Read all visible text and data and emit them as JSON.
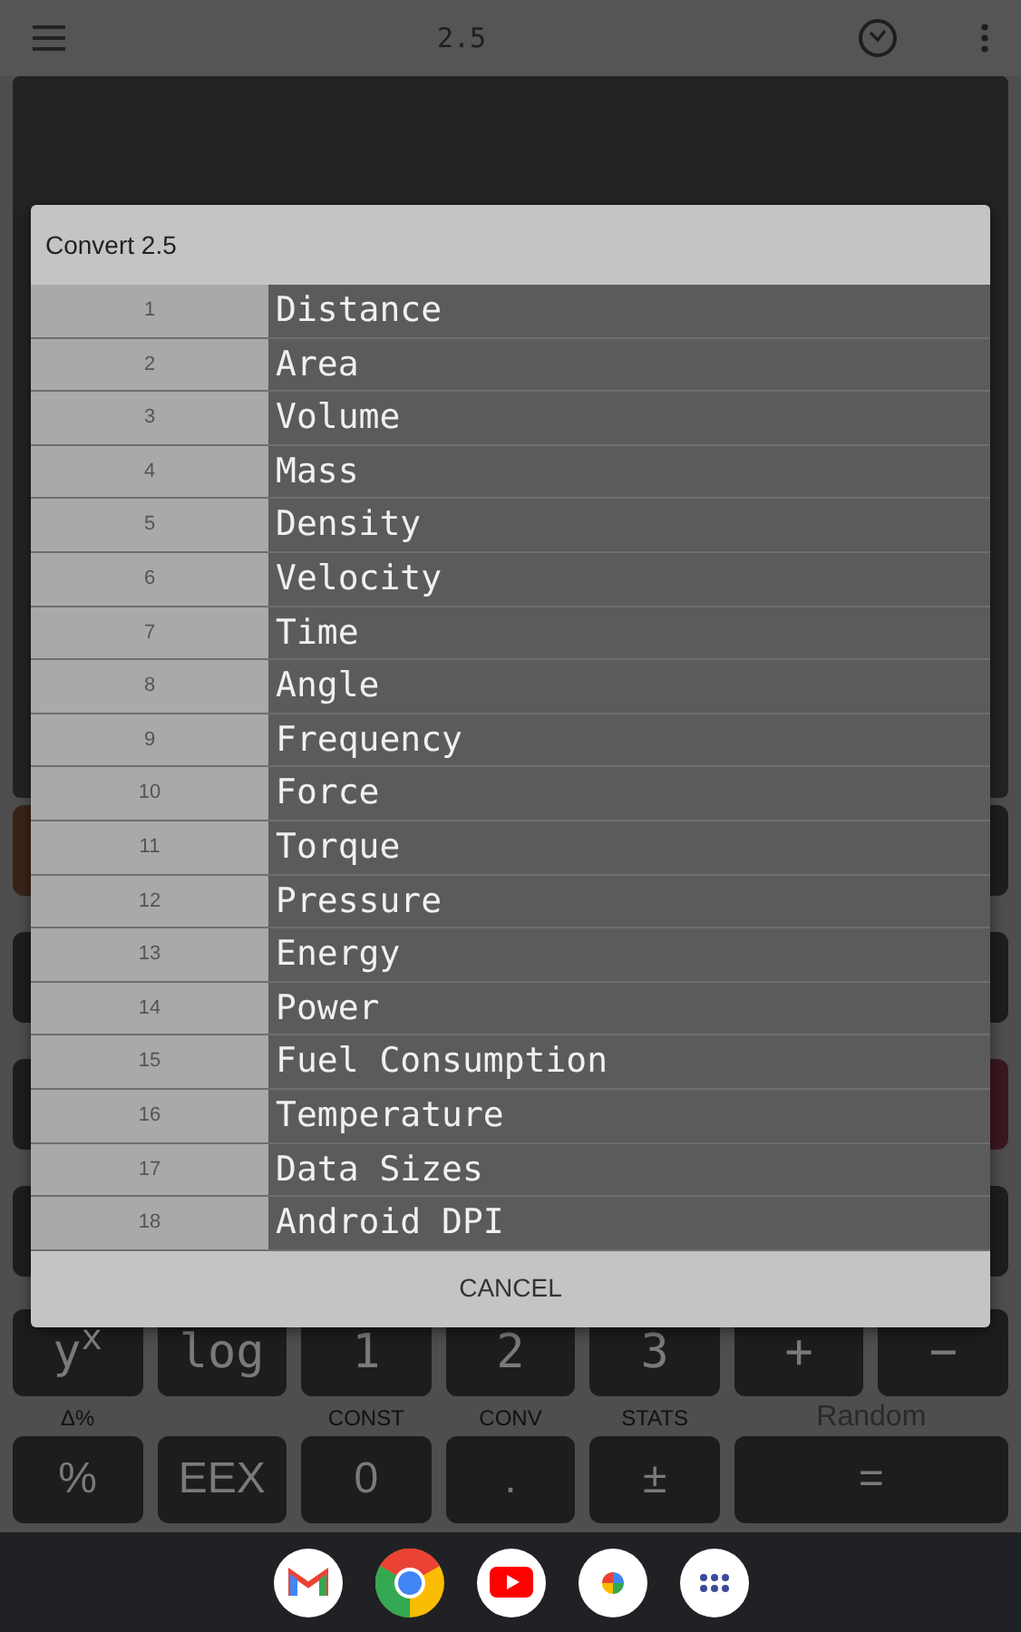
{
  "top_bar": {
    "title": "2.5"
  },
  "dialog": {
    "title": "Convert 2.5",
    "items": [
      {
        "number": "1",
        "label": "Distance"
      },
      {
        "number": "2",
        "label": "Area"
      },
      {
        "number": "3",
        "label": "Volume"
      },
      {
        "number": "4",
        "label": "Mass"
      },
      {
        "number": "5",
        "label": "Density"
      },
      {
        "number": "6",
        "label": "Velocity"
      },
      {
        "number": "7",
        "label": "Time"
      },
      {
        "number": "8",
        "label": "Angle"
      },
      {
        "number": "9",
        "label": "Frequency"
      },
      {
        "number": "10",
        "label": "Force"
      },
      {
        "number": "11",
        "label": "Torque"
      },
      {
        "number": "12",
        "label": "Pressure"
      },
      {
        "number": "13",
        "label": "Energy"
      },
      {
        "number": "14",
        "label": "Power"
      },
      {
        "number": "15",
        "label": "Fuel Consumption"
      },
      {
        "number": "16",
        "label": "Temperature"
      },
      {
        "number": "17",
        "label": "Data Sizes"
      },
      {
        "number": "18",
        "label": "Android DPI"
      }
    ],
    "cancel": "CANCEL"
  },
  "keypad": {
    "row_1": [
      {
        "label": "y$^{x}$"
      },
      {
        "label": "log"
      },
      {
        "label": "1"
      },
      {
        "label": "2"
      },
      {
        "label": "3"
      },
      {
        "label": "+"
      },
      {
        "label": "−"
      }
    ],
    "row_2": [
      {
        "label": "%",
        "shift_label": "Δ%",
        "wide": false
      },
      {
        "label": "EEX",
        "wide": false
      },
      {
        "label": "0",
        "shift_label": "CONST",
        "wide": false
      },
      {
        "label": ".",
        "shift_label": "CONV",
        "wide": false
      },
      {
        "label": "±",
        "shift_label": "STATS",
        "wide": false
      },
      {
        "label": "=",
        "shift_label": "Random",
        "wide": true
      }
    ]
  }
}
